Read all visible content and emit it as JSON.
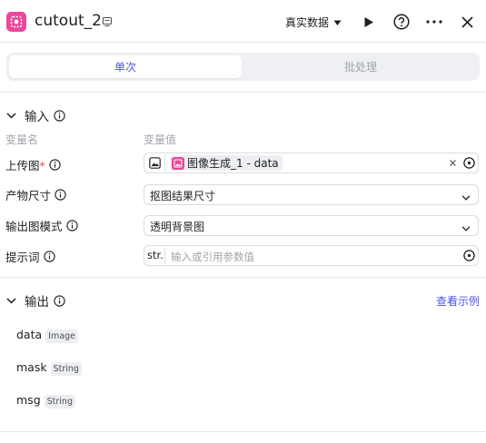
{
  "header": {
    "title": "cutout_2",
    "mode_label": "真实数据"
  },
  "tabs": [
    {
      "label": "单次"
    },
    {
      "label": "批处理"
    }
  ],
  "input_section": {
    "title": "输入",
    "col_name": "变量名",
    "col_value": "变量值",
    "rows": [
      {
        "label": "上传图",
        "required_mark": "*",
        "ref_label": "图像生成_1 - data"
      },
      {
        "label": "产物尺寸",
        "value": "抠图结果尺寸"
      },
      {
        "label": "输出图模式",
        "value": "透明背景图"
      },
      {
        "label": "提示词",
        "prefix": "str.",
        "placeholder": "输入或引用参数值"
      }
    ]
  },
  "output_section": {
    "title": "输出",
    "example_link": "查看示例",
    "items": [
      {
        "name": "data",
        "type": "Image"
      },
      {
        "name": "mask",
        "type": "String"
      },
      {
        "name": "msg",
        "type": "String"
      }
    ]
  },
  "colors": {
    "accent": "#4d53e8",
    "app_icon": "#e9489b",
    "required": "#e9484e"
  }
}
